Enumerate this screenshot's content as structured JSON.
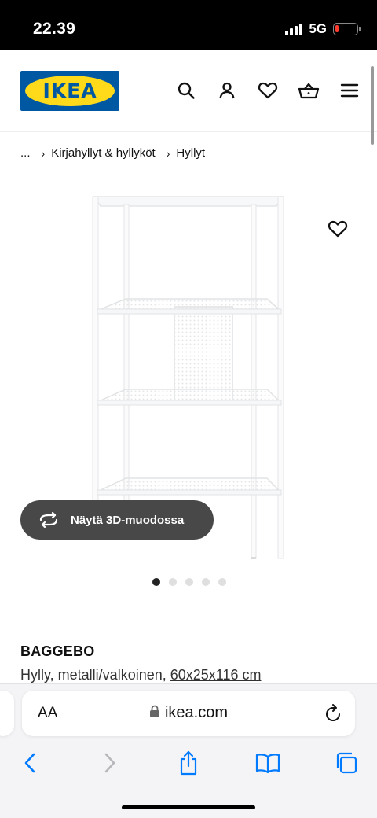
{
  "status_bar": {
    "time": "22.39",
    "network": "5G",
    "battery_level": 0.15
  },
  "header": {
    "logo_text": "IKEA",
    "icons": [
      "search-icon",
      "user-icon",
      "heart-icon",
      "basket-icon",
      "menu-icon"
    ]
  },
  "breadcrumb": {
    "ellipsis": "...",
    "items": [
      "Kirjahyllyt & hyllyköt",
      "Hyllyt"
    ]
  },
  "product": {
    "view_3d_label": "Näytä 3D-muodossa",
    "carousel": {
      "total": 5,
      "active": 1
    },
    "name": "BAGGEBO",
    "description": "Hylly, metalli/valkoinen,",
    "dimensions": "60x25x116 cm"
  },
  "browser": {
    "aa_label": "AA",
    "url": "ikea.com"
  },
  "colors": {
    "ikea_blue": "#0058a3",
    "ikea_yellow": "#ffda1a",
    "ios_blue": "#007aff"
  }
}
